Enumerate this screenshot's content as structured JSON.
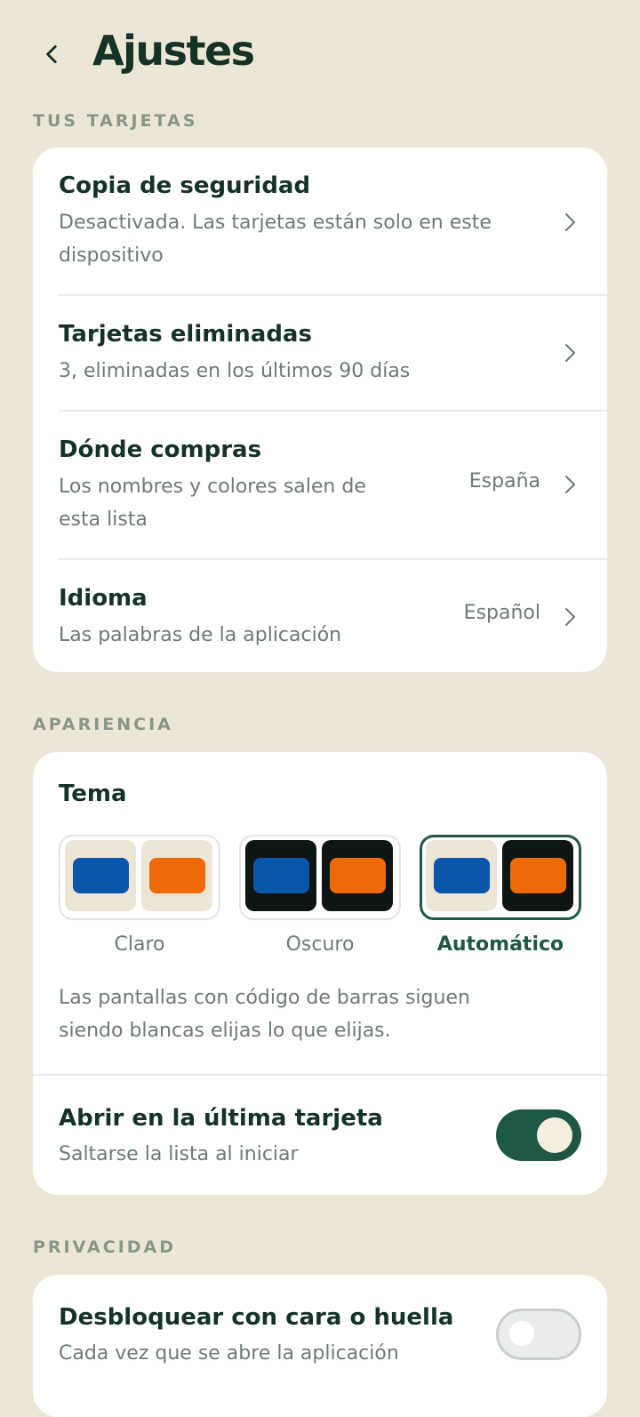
{
  "header": {
    "title": "Ajustes",
    "back_icon": "chevron-left-icon"
  },
  "sections": {
    "cards_label": "TUS TARJETAS",
    "appearance_label": "APARIENCIA",
    "privacy_label": "PRIVACIDAD"
  },
  "cards": {
    "backup": {
      "title": "Copia de seguridad",
      "subtitle_line1": "Desactivada. Las tarjetas están solo en este",
      "subtitle_line2": "dispositivo"
    },
    "deleted": {
      "title": "Tarjetas eliminadas",
      "subtitle": "3, eliminadas en los últimos 90 días"
    },
    "shop": {
      "title": "Dónde compras",
      "subtitle_line1": "Los nombres y colores salen de",
      "subtitle_line2": "esta lista",
      "value": "España"
    },
    "language": {
      "title": "Idioma",
      "subtitle": "Las palabras de la aplicación",
      "value": "Español"
    }
  },
  "appearance": {
    "theme_title": "Tema",
    "options": [
      {
        "label": "Claro",
        "selected": false
      },
      {
        "label": "Oscuro",
        "selected": false
      },
      {
        "label": "Automático",
        "selected": true
      }
    ],
    "note_line1": "Las pantallas con código de barras siguen",
    "note_line2": "siendo blancas elijas lo que elijas.",
    "open_last": {
      "title": "Abrir en la última tarjeta",
      "subtitle": "Saltarse la lista al iniciar",
      "enabled": true
    }
  },
  "privacy": {
    "unlock": {
      "title": "Desbloquear con cara o huella",
      "subtitle": "Cada vez que se abre la aplicación",
      "enabled": false
    }
  },
  "colors": {
    "background": "#ECE6D6",
    "card": "#FFFFFF",
    "primary_text": "#143326",
    "secondary_text": "#6E7A72",
    "section_label": "#8A9688",
    "accent": "#1F5746",
    "swatch_blue": "#0A56AA",
    "swatch_orange": "#EE6A08",
    "light_bg": "#ECE6D6",
    "dark_bg": "#0D1612"
  }
}
